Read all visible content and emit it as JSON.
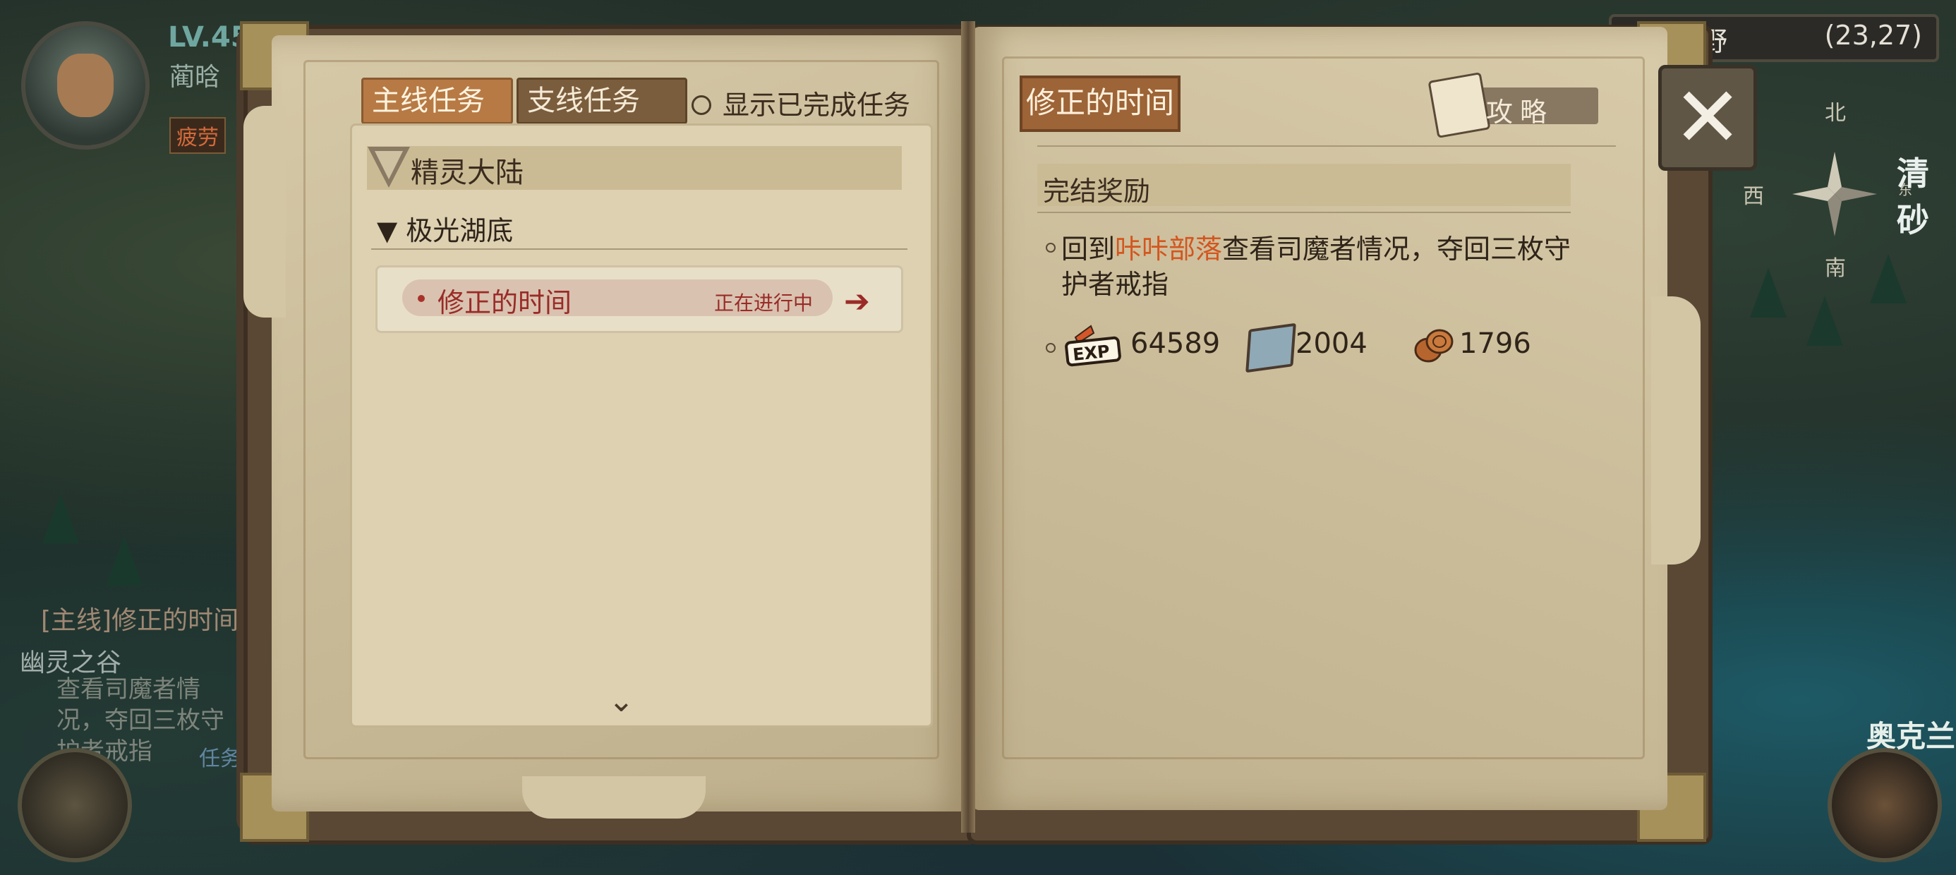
{
  "hud": {
    "level": "LV.45",
    "player_name": "蔺晗",
    "fatigue_label": "疲劳",
    "quest_tag": "[主线]修正的时间",
    "quest_location": "幽灵之谷",
    "quest_desc": "查看司魔者情况，夺回三枚守护者戒指",
    "task_label": "任务"
  },
  "minimap": {
    "zone": "野",
    "coords": "(23,27)",
    "compass": {
      "north": "北",
      "south": "南",
      "west": "西",
      "east": "东"
    },
    "label_top_right": "清砂",
    "label_bottom_right": "奥克兰"
  },
  "left_page": {
    "tabs": [
      {
        "label": "主线任务",
        "active": true
      },
      {
        "label": "支线任务",
        "active": false
      }
    ],
    "show_completed_label": "显示已完成任务",
    "region": "精灵大陆",
    "zone": "▼ 极光湖底",
    "quests": [
      {
        "name": "修正的时间",
        "status": "正在进行中"
      }
    ]
  },
  "right_page": {
    "title": "修正的时间",
    "guide_label": "攻略",
    "reward_section_label": "完结奖励",
    "description": {
      "prefix": "回到",
      "highlight": "咔咔部落",
      "suffix": "查看司魔者情况，夺回三枚守护者戒指"
    },
    "rewards": [
      {
        "icon": "exp-icon",
        "value": "64589"
      },
      {
        "icon": "book-icon",
        "value": "2004"
      },
      {
        "icon": "coin-icon",
        "value": "1796"
      }
    ]
  },
  "colors": {
    "accent_tab": "#b77a45",
    "quest_red": "#9a2b27",
    "highlight_orange": "#d3561f",
    "parchment": "#d6c9a8"
  }
}
